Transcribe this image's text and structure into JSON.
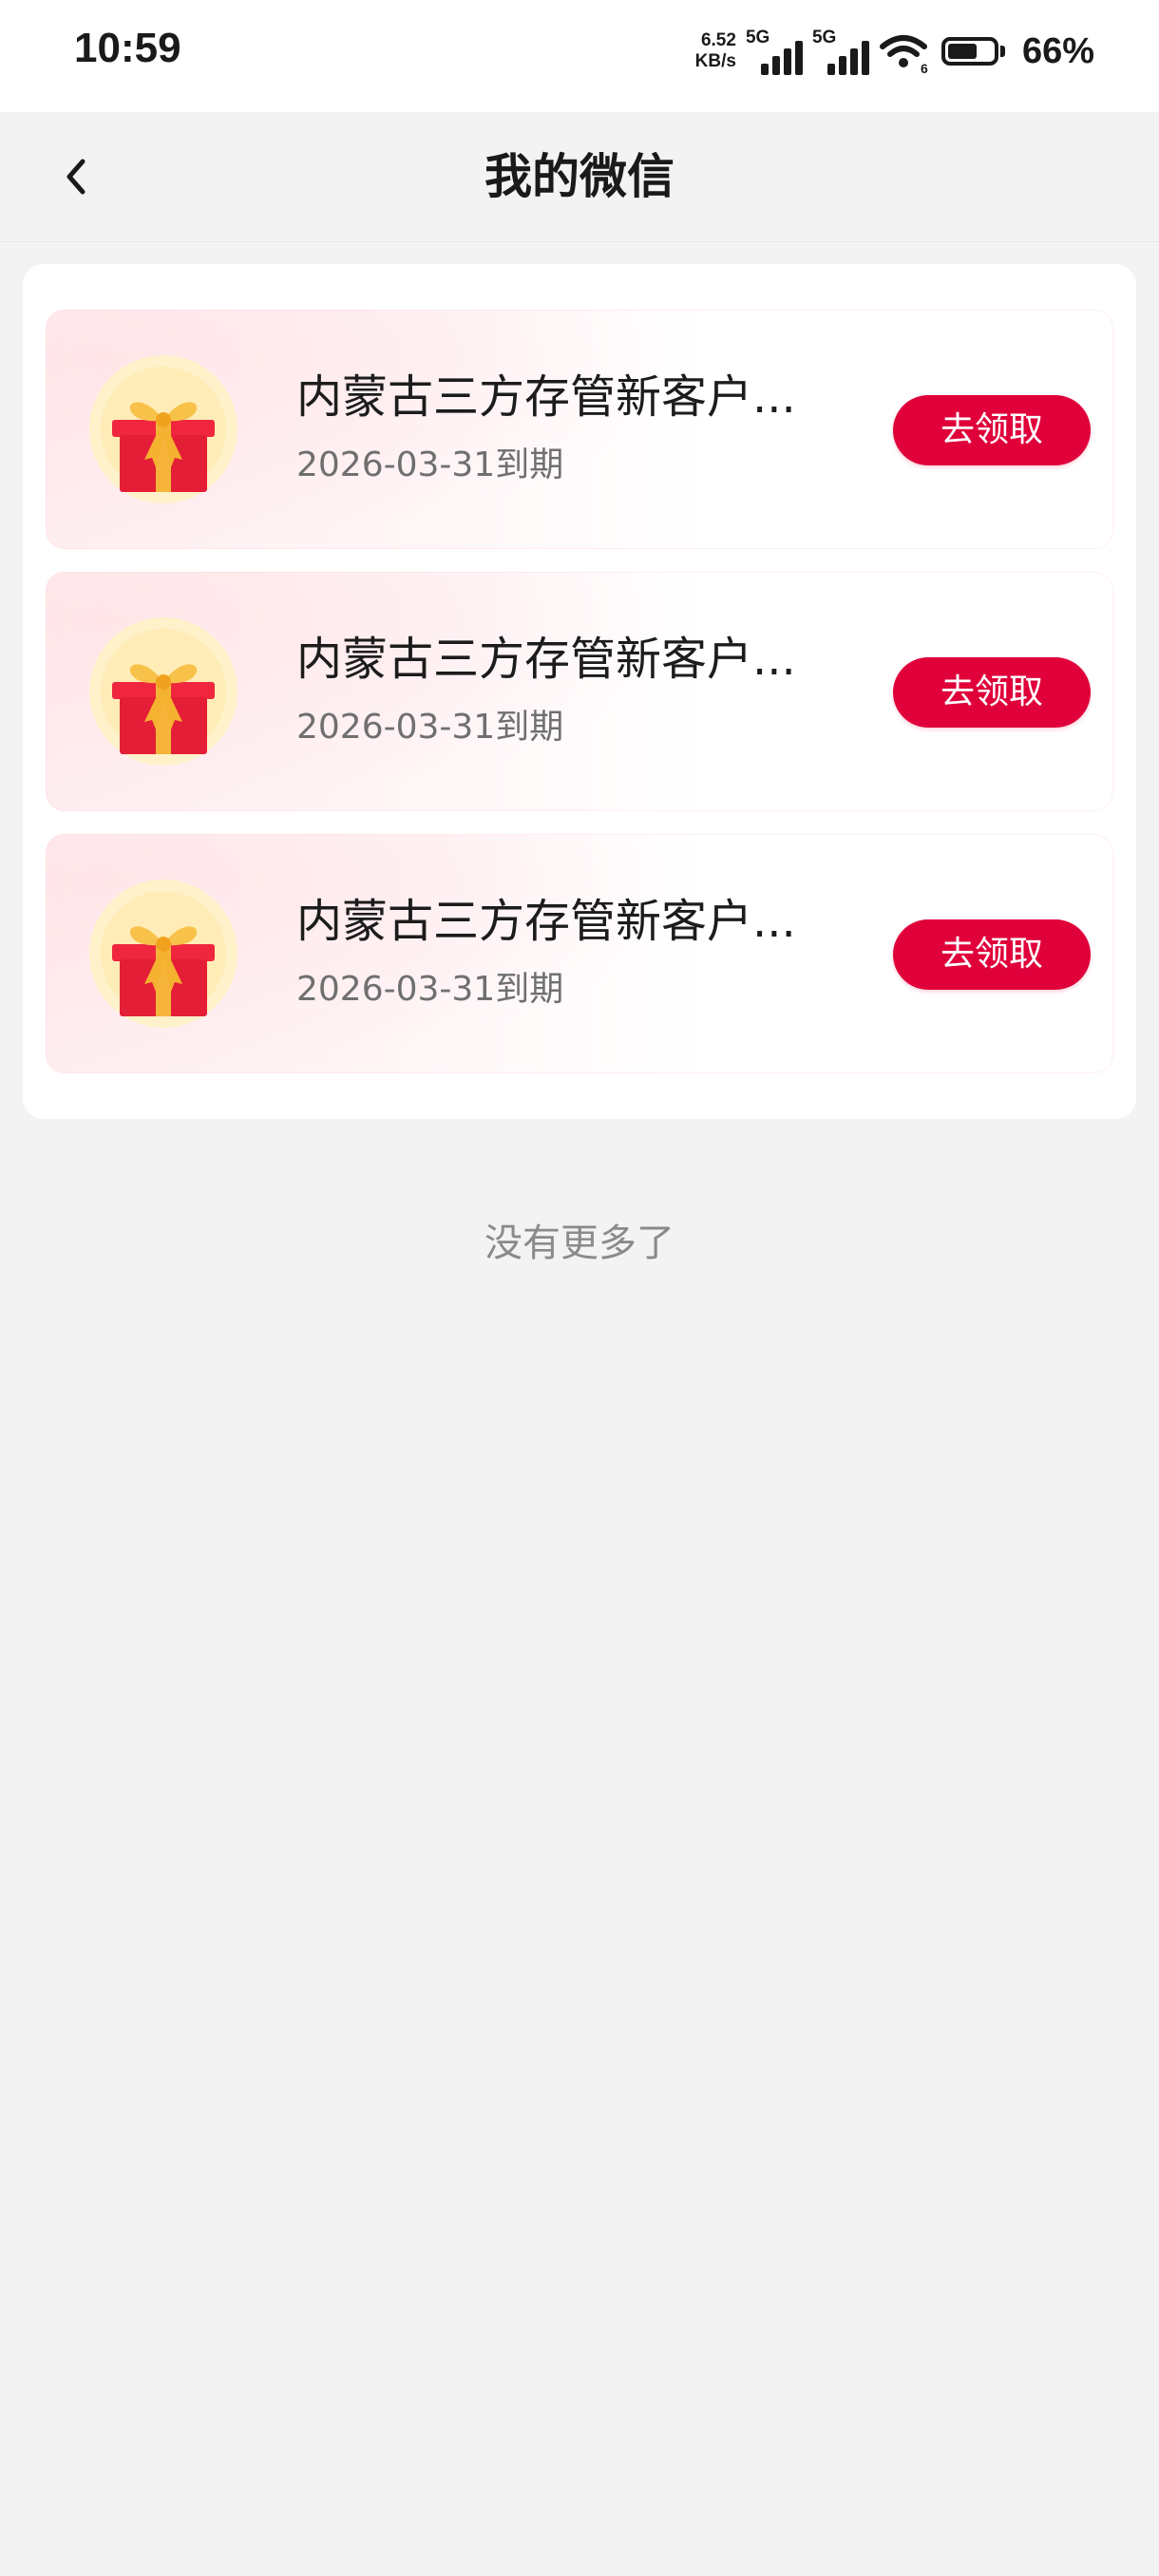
{
  "status_bar": {
    "time": "10:59",
    "net_speed_value": "6.52",
    "net_speed_unit": "KB/s",
    "sim1_tag": "5G",
    "sim2_tag": "5G",
    "wifi_badge": "6",
    "battery_level": 0.66,
    "battery_percent": "66%"
  },
  "header": {
    "title": "我的微信",
    "back_icon": "chevron-left-icon"
  },
  "coupons": [
    {
      "title": "内蒙古三方存管新客户...",
      "expiry": "2026-03-31到期",
      "button_label": "去领取",
      "icon": "gift-box-icon"
    },
    {
      "title": "内蒙古三方存管新客户...",
      "expiry": "2026-03-31到期",
      "button_label": "去领取",
      "icon": "gift-box-icon"
    },
    {
      "title": "内蒙古三方存管新客户...",
      "expiry": "2026-03-31到期",
      "button_label": "去领取",
      "icon": "gift-box-icon"
    }
  ],
  "footer_text": "没有更多了",
  "colors": {
    "accent": "#e0003a",
    "background": "#f3f3f3",
    "card": "#ffffff",
    "muted_text": "#8a8a8a"
  }
}
